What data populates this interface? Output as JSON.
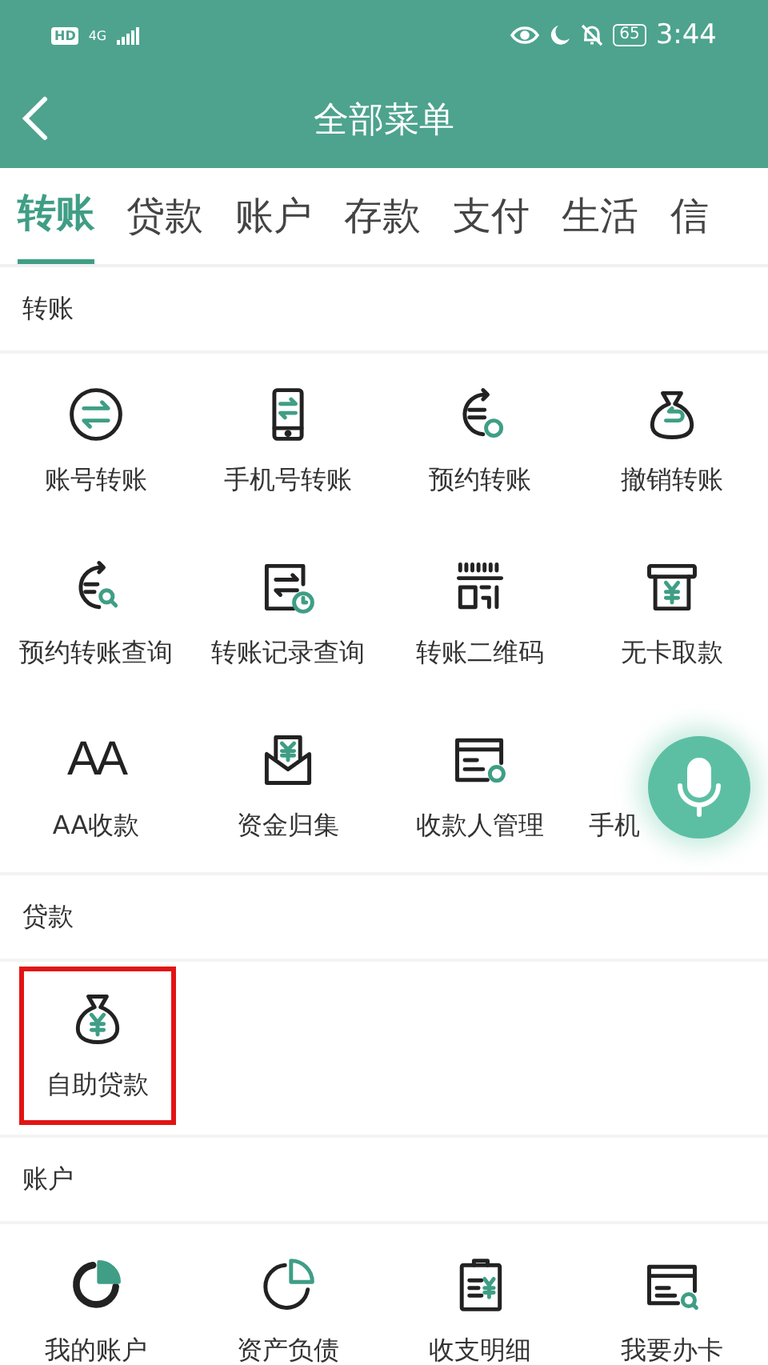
{
  "status_bar": {
    "hd": "HD",
    "network": "4G",
    "battery": "65",
    "time": "3:44"
  },
  "header": {
    "title": "全部菜单"
  },
  "tabs": [
    {
      "label": "转账",
      "selected": true
    },
    {
      "label": "贷款",
      "selected": false
    },
    {
      "label": "账户",
      "selected": false
    },
    {
      "label": "存款",
      "selected": false
    },
    {
      "label": "支付",
      "selected": false
    },
    {
      "label": "生活",
      "selected": false
    },
    {
      "label": "信",
      "selected": false
    }
  ],
  "sections": [
    {
      "title": "转账",
      "items": [
        {
          "label": "账号转账",
          "highlighted": false
        },
        {
          "label": "手机号转账",
          "highlighted": false
        },
        {
          "label": "预约转账",
          "highlighted": false
        },
        {
          "label": "撤销转账",
          "highlighted": false
        },
        {
          "label": "预约转账查询",
          "highlighted": false
        },
        {
          "label": "转账记录查询",
          "highlighted": false
        },
        {
          "label": "转账二维码",
          "highlighted": false
        },
        {
          "label": "无卡取款",
          "highlighted": false
        },
        {
          "label": "AA收款",
          "glyph": "AA",
          "highlighted": false
        },
        {
          "label": "资金归集",
          "highlighted": false
        },
        {
          "label": "收款人管理",
          "highlighted": false
        },
        {
          "label": "手机",
          "kind": "covered",
          "highlighted": false
        }
      ]
    },
    {
      "title": "贷款",
      "items": [
        {
          "label": "自助贷款",
          "highlighted": true
        }
      ]
    },
    {
      "title": "账户",
      "items": [
        {
          "label": "我的账户",
          "highlighted": false
        },
        {
          "label": "资产负债",
          "highlighted": false
        },
        {
          "label": "收支明细",
          "highlighted": false
        },
        {
          "label": "我要办卡",
          "highlighted": false
        }
      ]
    }
  ]
}
